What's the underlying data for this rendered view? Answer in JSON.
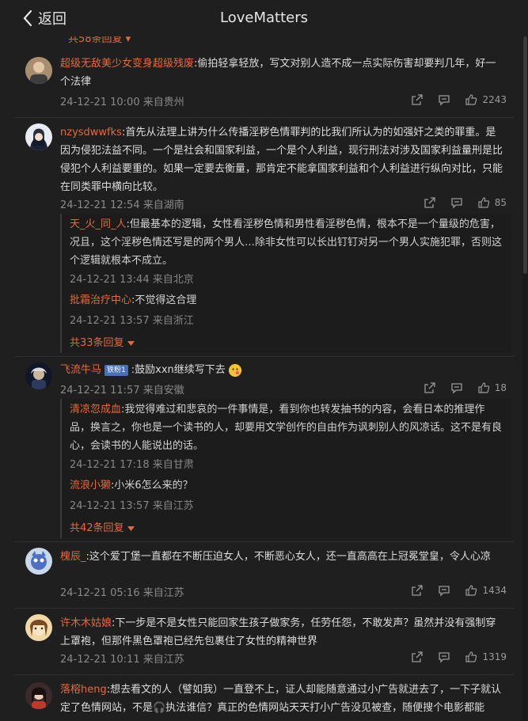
{
  "header": {
    "back_label": "返回",
    "title": "LoveMatters"
  },
  "cut_top_text": "共58条回复",
  "comments": [
    {
      "user": "超级无敌美少女变身超级残废",
      "text": "偷拍轻拿轻放，写文对别人造不成一点实际伤害却要判几年，好一个法律",
      "time": "24-12-21 10:00 来自贵州",
      "likes": "2243"
    },
    {
      "user": "nzysdwwfks",
      "text": "首先从法理上讲为什么传播淫秽色情罪判的比我们所认为的如强奸之类的罪重。是因为侵犯法益不同。一个是社会和国家利益，一个是个人利益，现行刑法对涉及国家利益量刑是比侵犯个人利益要重的。如果一定要去衡量，那肯定不能拿国家利益和个人利益进行纵向对比，只能在同类罪中横向比较。",
      "time": "24-12-21 12:54 来自湖南",
      "likes": "85",
      "replies": [
        {
          "user": "天_火_同_人",
          "text": "但最基本的逻辑，女性看淫秽色情和男性看淫秽色情，根本不是一个量级的危害，况且，这个淫秽色情还写是的两个男人…除非女性可以长出钉钉对另一个男人实施犯罪，否则这个逻辑就根本不成立。",
          "time": "24-12-21 13:44 来自北京"
        },
        {
          "user": "批霜治疗中心",
          "text": "不觉得这合理",
          "time": "24-12-21 13:57 来自浙江"
        }
      ],
      "more_replies": "共33条回复"
    },
    {
      "user": "飞流牛马",
      "badge": "铁粉1",
      "text": "鼓励xxn继续写下去",
      "time": "24-12-21 11:57 来自安徽",
      "likes": "18",
      "replies": [
        {
          "user": "清凉忽成血",
          "text": "我觉得难过和悲哀的一件事情是，看到你也转发抽书的内容，会看日本的推理作品，换言之，你也是一个读书的人，却要用文学创作的自由作为讽刺别人的风凉话。这不是有良心，会读书的人能说出的话。",
          "time": "24-12-21 17:18 来自甘肃"
        },
        {
          "user": "流浪小獭",
          "text": "小米6怎么来的？",
          "time": "24-12-21 13:57 来自江苏"
        }
      ],
      "more_replies": "共42条回复"
    },
    {
      "user": "槐辰_",
      "text": "这个爱丁堡一直都在不断压迫女人，不断恶心女人，还一直高高在上冠冕堂皇，令人心凉",
      "time": "24-12-21 05:16 来自江苏",
      "likes": "1434"
    },
    {
      "user": "许木木姑娘",
      "text": "下一步是不是女性只能回家生孩子做家务，任劳任怨，不敢发声？虽然并没有强制穿上罩袍，但那件黑色罩袍已经先包裹住了女性的精神世界",
      "time": "24-12-21 10:11 来自江苏",
      "likes": "1319"
    },
    {
      "user": "落榕heng",
      "text": "想去看文的人（譬如我）一直登不上，证人却能随意通过小广告就进去了，一下子就认定了色情网站，不是🎧执法谁信？真正的色情网站天天打小广告没见被查，随便搜个电影都能",
      "time": "",
      "likes": ""
    }
  ],
  "colors": {
    "accent": "#e46a3c",
    "background": "#1f1f1f"
  },
  "icons": [
    "back-chevron-icon",
    "share-icon",
    "comment-icon",
    "thumbs-up-icon",
    "caret-down-icon"
  ]
}
